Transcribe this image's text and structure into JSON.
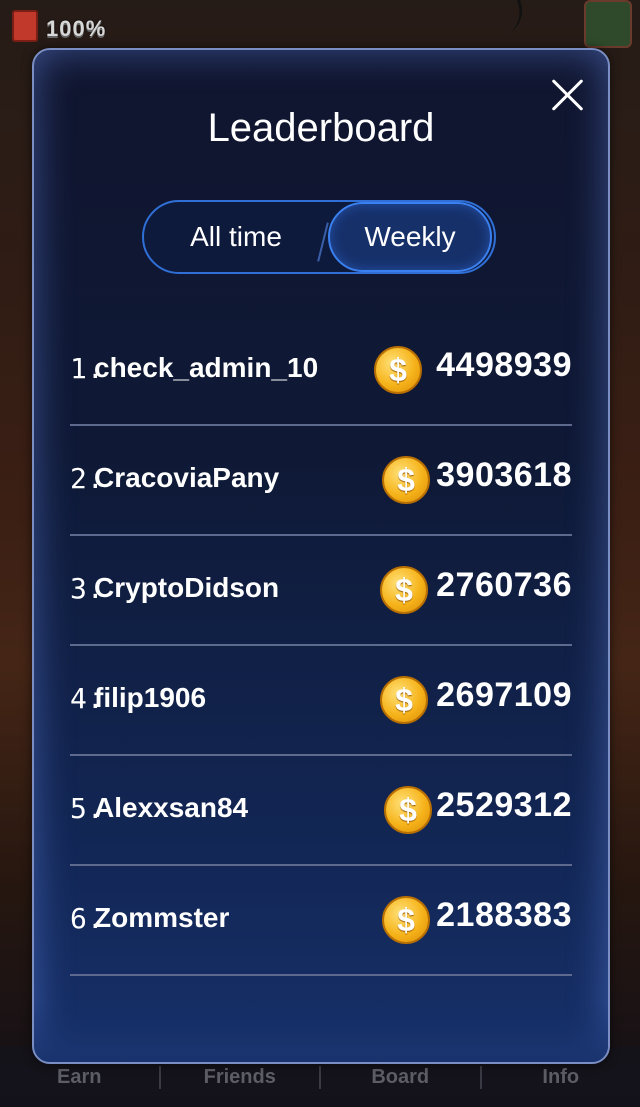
{
  "status": {
    "battery_text": "100%"
  },
  "modal": {
    "title": "Leaderboard",
    "tabs": [
      {
        "label": "All time",
        "selected": false
      },
      {
        "label": "Weekly",
        "selected": true
      }
    ]
  },
  "leaderboard": [
    {
      "rank": "1.",
      "name": "check_admin_10",
      "score": "4498939"
    },
    {
      "rank": "2.",
      "name": "CracoviaPany",
      "score": "3903618"
    },
    {
      "rank": "3.",
      "name": "CryptoDidson",
      "score": "2760736"
    },
    {
      "rank": "4.",
      "name": "filip1906",
      "score": "2697109"
    },
    {
      "rank": "5.",
      "name": "Alexxsan84",
      "score": "2529312"
    },
    {
      "rank": "6.",
      "name": "Zommster",
      "score": "2188383"
    }
  ],
  "coin_symbol": "$",
  "bottom_nav": [
    {
      "label": "Earn"
    },
    {
      "label": "Friends"
    },
    {
      "label": "Board"
    },
    {
      "label": "Info"
    }
  ],
  "colors": {
    "accent": "#3a80f0",
    "coin": "#f6b31a",
    "panel": "#10152e"
  }
}
